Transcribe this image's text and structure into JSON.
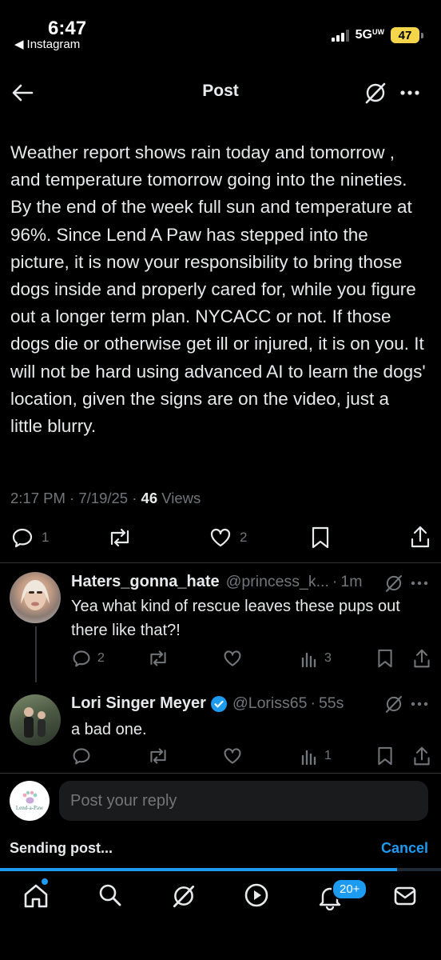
{
  "status_bar": {
    "time": "6:47",
    "back_app": "Instagram",
    "network": "5G",
    "network_sup": "UW",
    "battery": "47"
  },
  "header": {
    "title": "Post"
  },
  "tweet": {
    "text": "Weather report shows rain today and tomorrow , and temperature tomorrow going into the nineties. By the end of the week full sun and temperature at 96%. Since Lend A Paw has stepped into the picture, it is now your responsibility to bring those dogs inside and properly cared for, while you figure out a longer term plan. NYCACC or not.  If those dogs die or otherwise get ill or injured, it is on you.  It will not be hard using advanced AI to learn the dogs' location, given the signs are on the video, just a little blurry.",
    "time": "2:17 PM",
    "date": "7/19/25",
    "views_count": "46",
    "views_label": "Views",
    "reply_count": "1",
    "like_count": "2"
  },
  "replies": [
    {
      "name": "Haters_gonna_hate",
      "handle": "@princess_k...",
      "time": "1m",
      "text": "Yea what kind of rescue leaves these pups out there like that?!",
      "reply_count": "2",
      "views": "3"
    },
    {
      "name": "Lori Singer Meyer",
      "handle": "@Loriss65",
      "time": "55s",
      "text": "a bad one.",
      "views": "1"
    }
  ],
  "composer": {
    "placeholder": "Post your reply",
    "avatar_text": "Lend-a-Paw"
  },
  "upload": {
    "status": "Sending post...",
    "cancel": "Cancel",
    "progress": 0.9
  },
  "nav": {
    "notifications_badge": "20+"
  },
  "colors": {
    "accent": "#1d9bf0",
    "muted": "#71767b",
    "verified": "#1d9bf0",
    "battery": "#f5d54a"
  }
}
